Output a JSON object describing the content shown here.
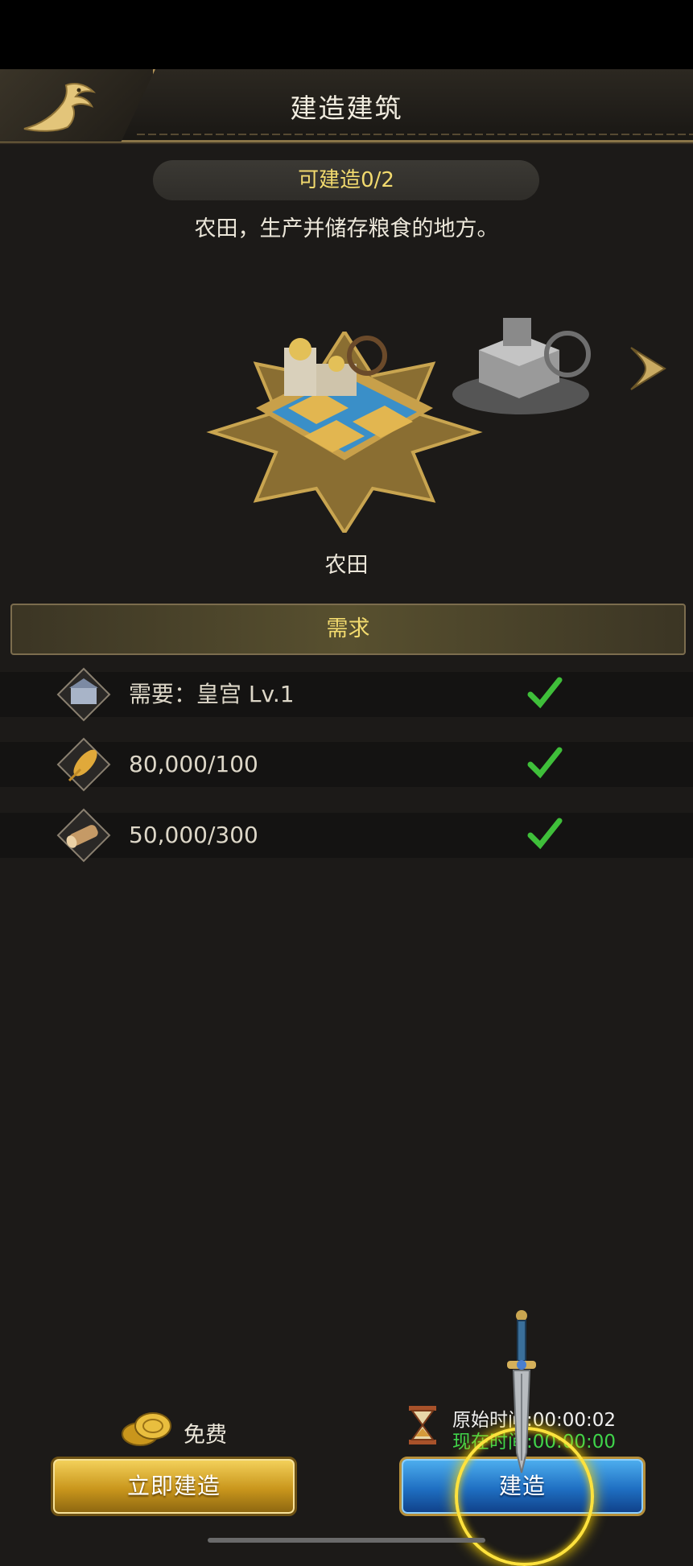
{
  "header": {
    "title": "建造建筑"
  },
  "build_count": {
    "label": "可建造0/2"
  },
  "description": "农田，生产并储存粮食的地方。",
  "building": {
    "name": "农田"
  },
  "requirements": {
    "header": "需求",
    "items": [
      {
        "text": "需要：皇宫  Lv.1",
        "icon": "palace-icon",
        "met": true
      },
      {
        "text": "80,000/100",
        "icon": "grain-icon",
        "met": true
      },
      {
        "text": "50,000/300",
        "icon": "wood-icon",
        "met": true
      }
    ]
  },
  "footer": {
    "free_label": "免费",
    "original_time": "原始时间:00:00:02",
    "current_time": "现在时间:00:00:00",
    "instant_build_label": "立即建造",
    "build_label": "建造"
  },
  "colors": {
    "accent_gold": "#f2da6e",
    "check_green": "#3fbf3a",
    "time_green": "#3fd44a"
  }
}
